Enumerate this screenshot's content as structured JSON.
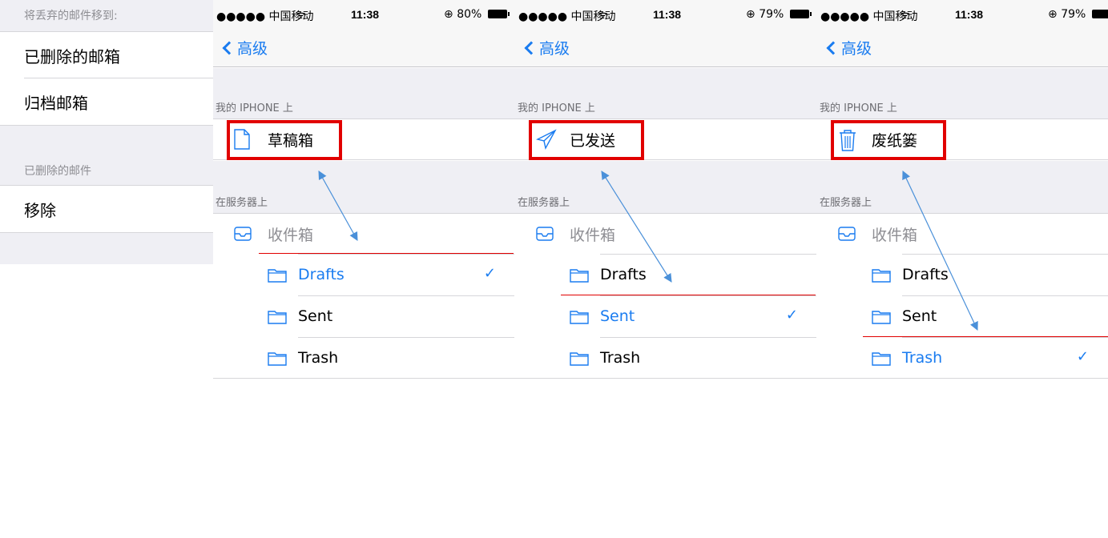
{
  "left_panel": {
    "header1": "将丢弃的邮件移到:",
    "option1": "已删除的邮箱",
    "option2": "归档邮箱",
    "header2": "已删除的邮件",
    "option3": "移除"
  },
  "phones": [
    {
      "status": {
        "carrier": "●●●●● 中国移动",
        "time": "11:38",
        "battery": "80%"
      },
      "back_label": "高级",
      "section_local": "我的 IPHONE 上",
      "mailbox_label": "草稿箱",
      "mailbox_icon": "draft-document-icon",
      "section_server": "在服务器上",
      "inbox_label": "收件箱",
      "folders": [
        "Drafts",
        "Sent",
        "Trash"
      ],
      "selected": "Drafts"
    },
    {
      "status": {
        "carrier": "●●●●● 中国移动",
        "time": "11:38",
        "battery": "79%"
      },
      "back_label": "高级",
      "section_local": "我的 IPHONE 上",
      "mailbox_label": "已发送",
      "mailbox_icon": "sent-paperplane-icon",
      "section_server": "在服务器上",
      "inbox_label": "收件箱",
      "folders": [
        "Drafts",
        "Sent",
        "Trash"
      ],
      "selected": "Sent"
    },
    {
      "status": {
        "carrier": "●●●●● 中国移动",
        "time": "11:38",
        "battery": "79%"
      },
      "back_label": "高级",
      "section_local": "我的 IPHONE 上",
      "mailbox_label": "废纸篓",
      "mailbox_icon": "trash-can-icon",
      "section_server": "在服务器上",
      "inbox_label": "收件箱",
      "folders": [
        "Drafts",
        "Sent",
        "Trash"
      ],
      "selected": "Trash"
    }
  ],
  "checkmark": "✓",
  "colors": {
    "accent": "#1a7cf0",
    "highlight": "#e10000",
    "group_bg": "#efeff4"
  }
}
